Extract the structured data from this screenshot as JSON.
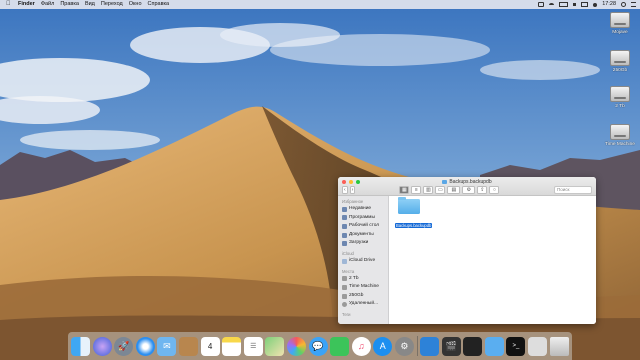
{
  "menubar": {
    "apple_icon": "apple-icon",
    "items": [
      {
        "label": "Finder",
        "bold": true
      },
      {
        "label": "Файл"
      },
      {
        "label": "Правка"
      },
      {
        "label": "Вид"
      },
      {
        "label": "Переход"
      },
      {
        "label": "Окно"
      },
      {
        "label": "Справка"
      }
    ],
    "status_icons": [
      "cast-icon",
      "wifi-icon",
      "battery-icon",
      "volume-icon",
      "keyboard-icon",
      "user-icon"
    ],
    "clock": "17:28"
  },
  "desktop_icons": [
    {
      "label": "Mojave",
      "icon": "drive-icon"
    },
    {
      "label": "250Gb",
      "icon": "drive-icon"
    },
    {
      "label": "2 Tb",
      "icon": "drive-icon"
    },
    {
      "label": "Time Machine",
      "icon": "drive-icon"
    }
  ],
  "finder": {
    "title": "Backups.backupdb",
    "toolbar": {
      "back": "‹",
      "forward": "›",
      "view_buttons": [
        "icon-view",
        "list-view",
        "column-view",
        "gallery-view"
      ],
      "search_placeholder": "Поиск"
    },
    "sidebar": {
      "sections": [
        {
          "title": "Избранное",
          "items": [
            {
              "label": "Недавние",
              "icon": "clock-icon"
            },
            {
              "label": "Программы",
              "icon": "apps-icon"
            },
            {
              "label": "Рабочий стол",
              "icon": "desktop-icon"
            },
            {
              "label": "Документы",
              "icon": "document-icon"
            },
            {
              "label": "Загрузки",
              "icon": "download-icon"
            }
          ]
        },
        {
          "title": "iCloud",
          "items": [
            {
              "label": "iCloud Drive",
              "icon": "cloud-icon"
            }
          ]
        },
        {
          "title": "Места",
          "items": [
            {
              "label": "2 Tb",
              "icon": "drive-icon"
            },
            {
              "label": "Time Machine",
              "icon": "drive-icon"
            },
            {
              "label": "250Gb",
              "icon": "drive-icon"
            },
            {
              "label": "Удаленный...",
              "icon": "disc-icon"
            }
          ]
        },
        {
          "title": "Теги",
          "items": []
        }
      ]
    },
    "content": {
      "items": [
        {
          "label": "Backups.backupdb",
          "icon": "folder-icon",
          "selected": true
        }
      ]
    }
  },
  "dock": {
    "apps": [
      "finder-icon",
      "siri-icon",
      "launchpad-icon",
      "safari-icon",
      "mail-icon",
      "contacts-icon",
      "calendar-icon",
      "notes-icon",
      "reminders-icon",
      "maps-icon",
      "photos-icon",
      "messages-icon",
      "facetime-icon",
      "music-icon",
      "appstore-icon",
      "system-preferences-icon",
      "separator",
      "display-icon",
      "final-cut-icon",
      "compressor-icon",
      "folder-icon",
      "terminal-icon",
      "remote-icon",
      "trash-icon"
    ],
    "calendar_day": "4"
  },
  "colors": {
    "selection": "#1469d6",
    "folder": "#55aee9",
    "sky": "#4a7fc0",
    "sand": "#c79a5b"
  }
}
